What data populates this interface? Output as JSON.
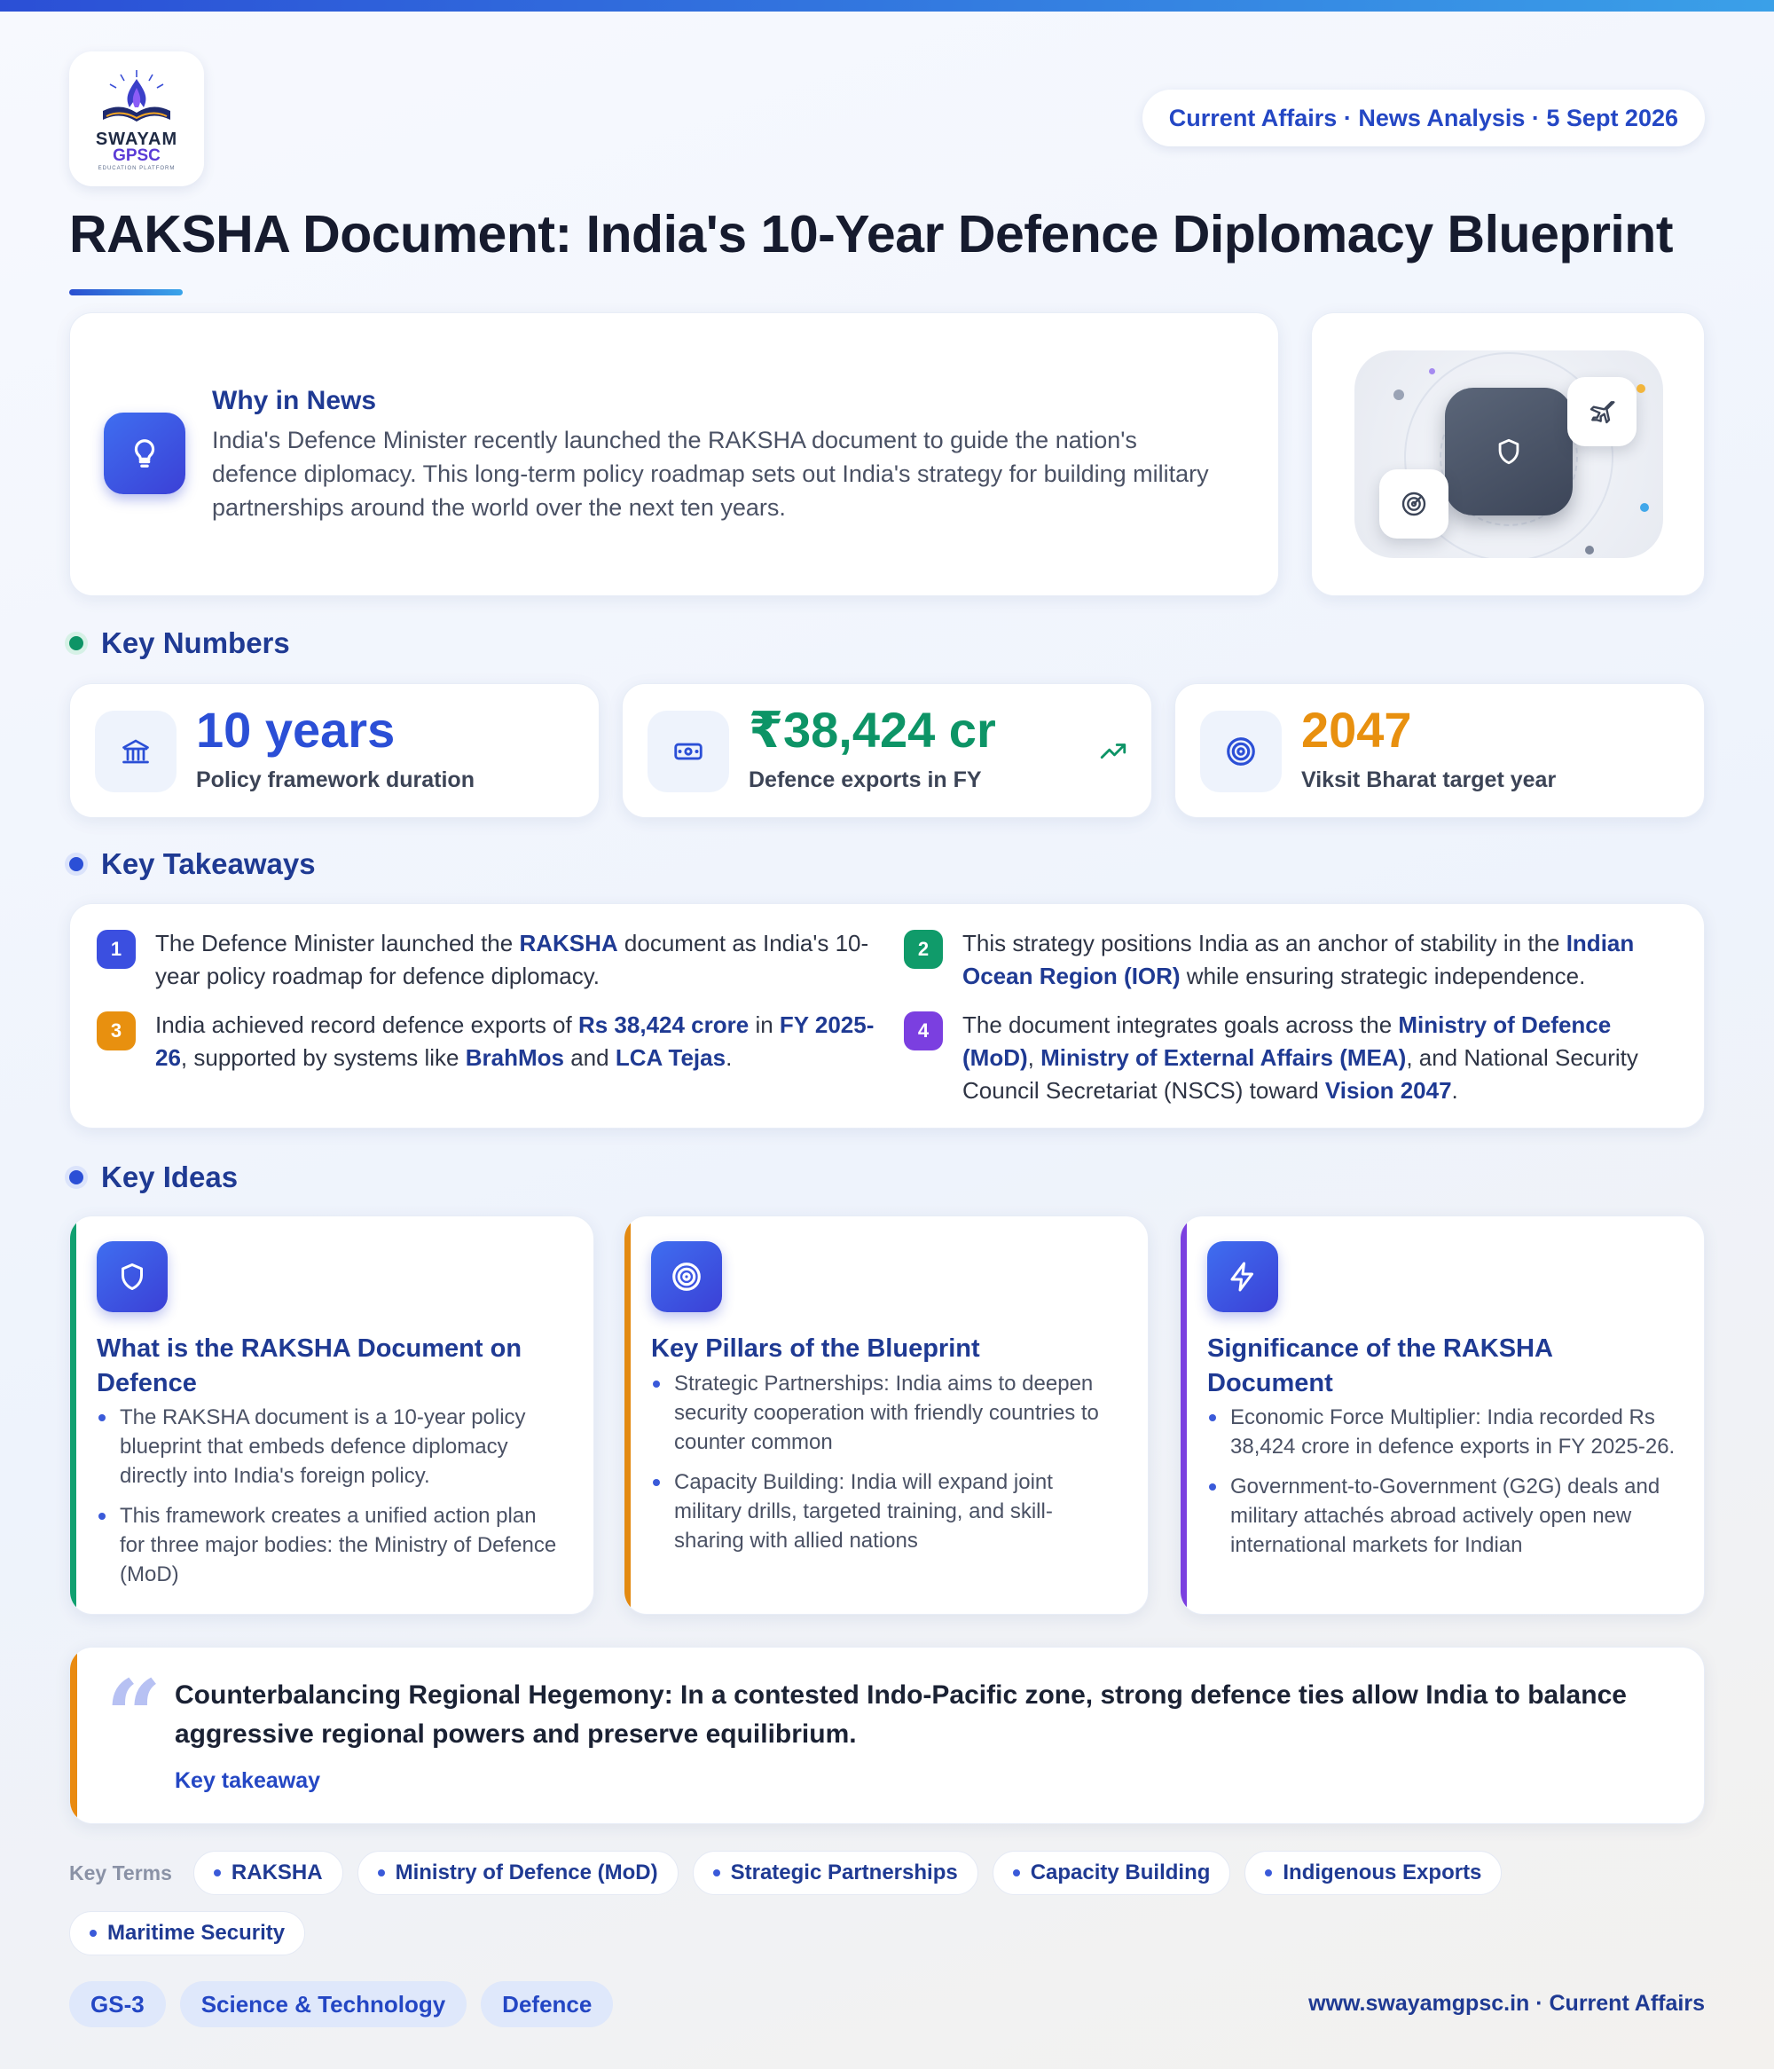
{
  "brand": {
    "name": "SWAYAM",
    "sub": "GPSC",
    "tagline": "EDUCATION PLATFORM"
  },
  "header": {
    "date_pill": "Current Affairs · News Analysis · 5 Sept 2026",
    "title": "RAKSHA Document: India's 10-Year Defence Diplomacy Blueprint"
  },
  "why": {
    "heading": "Why in News",
    "text": "India's Defence Minister recently launched the RAKSHA document to guide the nation's defence diplomacy. This long-term policy roadmap sets out India's strategy for building military partnerships around the world over the next ten years."
  },
  "sections": {
    "numbers": "Key Numbers",
    "takeaways": "Key Takeaways",
    "ideas": "Key Ideas"
  },
  "numbers": [
    {
      "value": "10 years",
      "label": "Policy framework duration",
      "color": "#2b4fd6",
      "icon": "bank-icon"
    },
    {
      "value": "₹38,424 cr",
      "label": "Defence exports in FY",
      "color": "#0d9466",
      "icon": "money-icon"
    },
    {
      "value": "2047",
      "label": "Viksit Bharat target year",
      "color": "#e8900f",
      "icon": "target-icon"
    }
  ],
  "takeaways": [
    {
      "n": "1",
      "color": "#3b4fe0",
      "parts": [
        "The Defence Minister launched the ",
        "RAKSHA",
        " document as India's 10-year policy roadmap for defence diplomacy."
      ]
    },
    {
      "n": "2",
      "color": "#109b6a",
      "parts": [
        "This strategy positions India as an anchor of stability in the ",
        "Indian Ocean Region (IOR)",
        " while ensuring strategic independence."
      ]
    },
    {
      "n": "3",
      "color": "#e8900f",
      "parts": [
        "India achieved record defence exports of ",
        "Rs 38,424 crore",
        " in ",
        "FY 2025-26",
        ", supported by systems like ",
        "BrahMos",
        " and ",
        "LCA Tejas",
        "."
      ]
    },
    {
      "n": "4",
      "color": "#7b3fe0",
      "parts": [
        "The document integrates goals across the ",
        "Ministry of Defence (MoD)",
        ", ",
        "Ministry of External Affairs (MEA)",
        ", and National Security Council Secretariat (NSCS) toward ",
        "Vision 2047",
        "."
      ]
    }
  ],
  "ideas": [
    {
      "title": "What is the RAKSHA Document on Defence",
      "icon": "shield-icon",
      "bar": "#10a070",
      "points": [
        "The RAKSHA document is a 10-year policy blueprint that embeds defence diplomacy directly into India's foreign policy.",
        "This framework creates a unified action plan for three major bodies: the Ministry of Defence (MoD)"
      ]
    },
    {
      "title": "Key Pillars of the Blueprint",
      "icon": "target-icon",
      "bar": "#e38a12",
      "points": [
        "Strategic Partnerships: India aims to deepen security cooperation with friendly countries to counter common",
        "Capacity Building: India will expand joint military drills, targeted training, and skill-sharing with allied nations"
      ]
    },
    {
      "title": "Significance of the RAKSHA Document",
      "icon": "bolt-icon",
      "bar": "#7b3fe0",
      "points": [
        "Economic Force Multiplier: India recorded Rs 38,424 crore in defence exports in FY 2025-26.",
        "Government-to-Government (G2G) deals and military attachés abroad actively open new international markets for Indian"
      ]
    }
  ],
  "quote": {
    "text": "Counterbalancing Regional Hegemony: In a contested Indo-Pacific zone, strong defence ties allow India to balance aggressive regional powers and preserve equilibrium.",
    "caption": "Key takeaway"
  },
  "terms": {
    "label": "Key Terms",
    "items": [
      "RAKSHA",
      "Ministry of Defence (MoD)",
      "Strategic Partnerships",
      "Capacity Building",
      "Indigenous Exports",
      "Maritime Security"
    ]
  },
  "footer": {
    "tags": [
      "GS-3",
      "Science & Technology",
      "Defence"
    ],
    "url": "www.swayamgpsc.in · Current Affairs"
  }
}
